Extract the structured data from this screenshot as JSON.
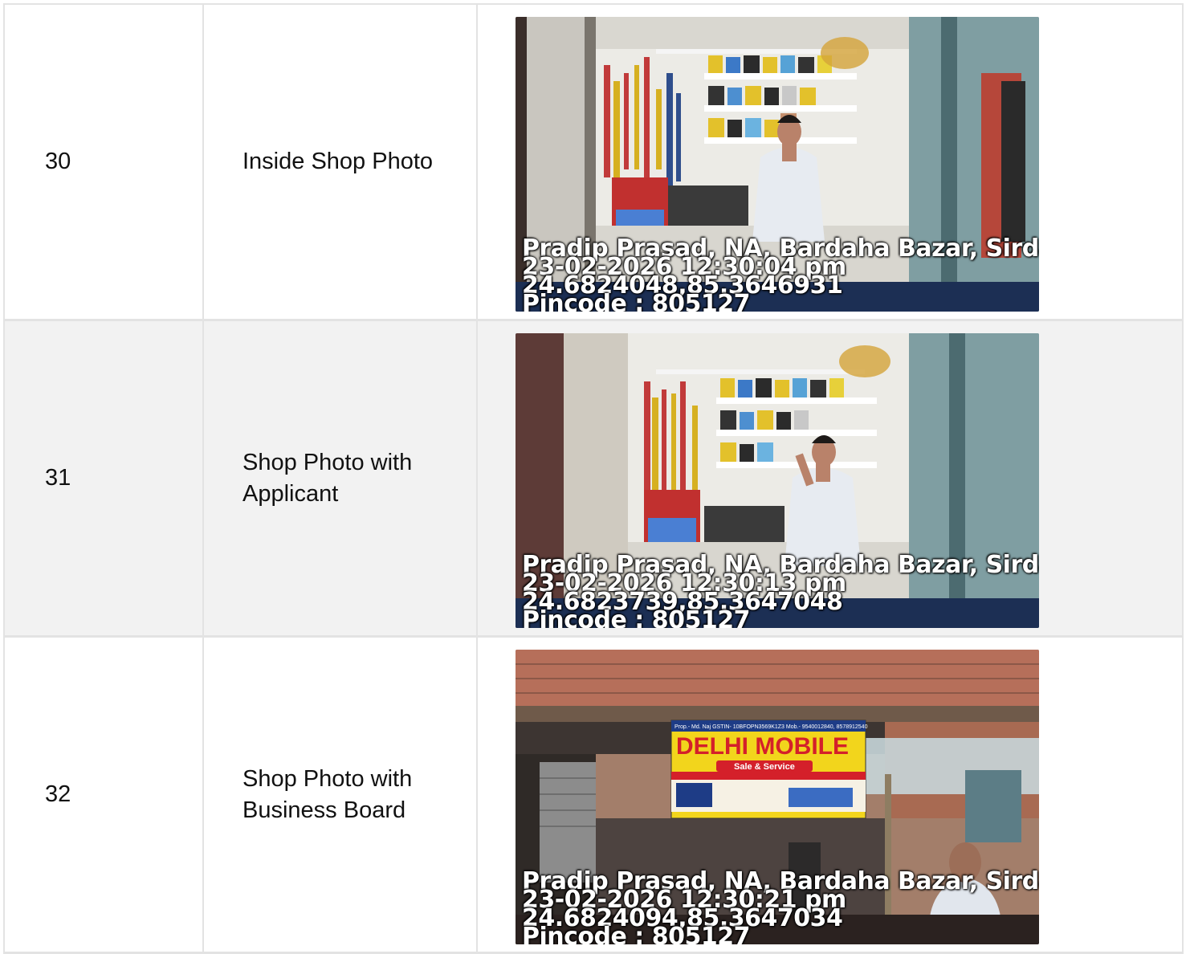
{
  "rows": [
    {
      "number": "30",
      "label": "Inside Shop Photo",
      "photo": {
        "scene": "shop-interior",
        "stamp": [
          "Pradip Prasad, NA, Bardaha Bazar, Sirdal",
          "23-02-2026 12:30:04 pm",
          "24.6824048,85.3646931",
          "Pincode : 805127"
        ]
      }
    },
    {
      "number": "31",
      "label": "Shop Photo with Applicant",
      "photo": {
        "scene": "shop-interior",
        "stamp": [
          "Pradip Prasad, NA, Bardaha Bazar, Sirdal",
          "23-02-2026 12:30:13 pm",
          "24.6823739,85.3647048",
          "Pincode : 805127"
        ]
      }
    },
    {
      "number": "32",
      "label": "Shop Photo with Business Board",
      "photo": {
        "scene": "shop-front",
        "board": {
          "top_line": "Prop.- Md. Naj   GSTIN- 10BFOPN3569K1Z3   Mob.- 9540012840, 8578912540",
          "title": "DELHI MOBILE",
          "subtitle": "Sale & Service"
        },
        "stamp": [
          "Pradip Prasad, NA, Bardaha Bazar, Sirdal",
          "23-02-2026 12:30:21 pm",
          "24.6824094,85.3647034",
          "Pincode : 805127"
        ]
      }
    }
  ],
  "colors": {
    "border": "#e3e3e3",
    "alt_row": "#f2f2f2",
    "board_yellow": "#f2d51c",
    "board_red": "#d4202a"
  }
}
